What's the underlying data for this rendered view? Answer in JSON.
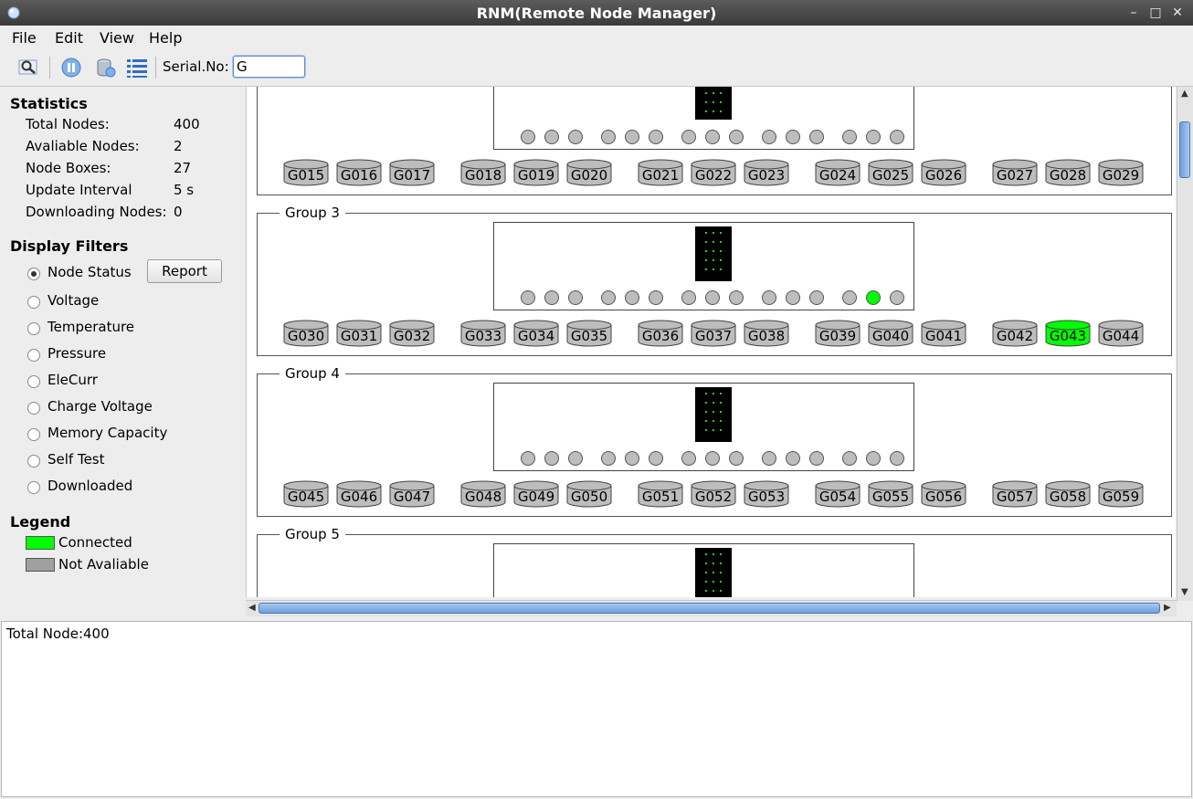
{
  "window": {
    "title": "RNM(Remote Node Manager)",
    "minimize": "–",
    "maximize": "□",
    "close": "✕"
  },
  "menu": [
    "File",
    "Edit",
    "View",
    "Help"
  ],
  "toolbar": {
    "serial_label": "Serial.No:",
    "serial_value": "G",
    "icons": [
      "search-icon",
      "pause-icon",
      "database-icon",
      "list-icon"
    ]
  },
  "statistics": {
    "title": "Statistics",
    "rows": [
      {
        "label": "Total Nodes:",
        "value": "400"
      },
      {
        "label": "Avaliable Nodes:",
        "value": "2"
      },
      {
        "label": "Node Boxes:",
        "value": "27"
      },
      {
        "label": "Update Interval",
        "value": "5 s"
      },
      {
        "label": "Downloading Nodes:",
        "value": "0"
      }
    ]
  },
  "filters": {
    "title": "Display Filters",
    "report_label": "Report",
    "selected": "Node Status",
    "options": [
      "Node Status",
      "Voltage",
      "Temperature",
      "Pressure",
      "EleCurr",
      "Charge Voltage",
      "Memory Capacity",
      "Self Test",
      "Downloaded"
    ]
  },
  "legend": {
    "title": "Legend",
    "items": [
      {
        "label": "Connected",
        "color": "#00ff00"
      },
      {
        "label": "Not Avaliable",
        "color": "#a0a0a0"
      }
    ]
  },
  "colors": {
    "connected": "#00ff00",
    "unavailable": "#bdbdbd",
    "accent": "#6e9edb"
  },
  "groups": [
    {
      "label": "",
      "nodes": [
        "G015",
        "G016",
        "G017",
        "G018",
        "G019",
        "G020",
        "G021",
        "G022",
        "G023",
        "G024",
        "G025",
        "G026",
        "G027",
        "G028",
        "G029"
      ],
      "connected_nodes": [],
      "connected_dots": []
    },
    {
      "label": "Group 3",
      "nodes": [
        "G030",
        "G031",
        "G032",
        "G033",
        "G034",
        "G035",
        "G036",
        "G037",
        "G038",
        "G039",
        "G040",
        "G041",
        "G042",
        "G043",
        "G044"
      ],
      "connected_nodes": [
        "G043"
      ],
      "connected_dots": [
        13
      ]
    },
    {
      "label": "Group 4",
      "nodes": [
        "G045",
        "G046",
        "G047",
        "G048",
        "G049",
        "G050",
        "G051",
        "G052",
        "G053",
        "G054",
        "G055",
        "G056",
        "G057",
        "G058",
        "G059"
      ],
      "connected_nodes": [],
      "connected_dots": []
    },
    {
      "label": "Group 5",
      "nodes": [],
      "connected_nodes": [],
      "connected_dots": []
    }
  ],
  "log": {
    "text": "Total Node:400"
  }
}
